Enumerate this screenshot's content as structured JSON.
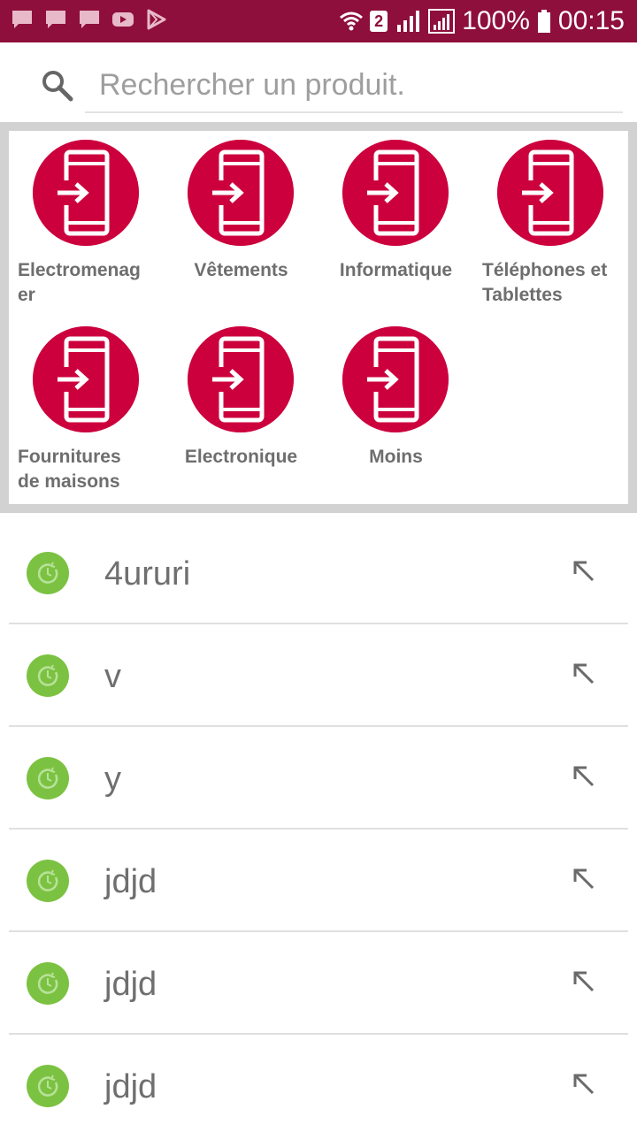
{
  "status_bar": {
    "battery": "100%",
    "time": "00:15",
    "sim_slot": "2",
    "bg_color": "#8e0f3b",
    "left_icons": [
      "message-icon",
      "message-icon",
      "message-icon",
      "youtube-icon",
      "play-store-icon"
    ],
    "right_icons": [
      "wifi-icon",
      "signal-icon",
      "signal-icon",
      "battery-icon"
    ]
  },
  "search": {
    "placeholder": "Rechercher un produit.",
    "value": ""
  },
  "categories": [
    {
      "label": "Electromenag\ner",
      "icon": "phone-login-icon"
    },
    {
      "label": "Vêtements",
      "icon": "phone-login-icon"
    },
    {
      "label": "Informatique",
      "icon": "phone-login-icon"
    },
    {
      "label": "Téléphones et\nTablettes",
      "icon": "phone-login-icon"
    },
    {
      "label": "Fournitures\nde maisons",
      "icon": "phone-login-icon"
    },
    {
      "label": "Electronique",
      "icon": "phone-login-icon"
    },
    {
      "label": "Moins",
      "icon": "phone-login-icon"
    }
  ],
  "history": [
    {
      "text": "4ururi"
    },
    {
      "text": "v"
    },
    {
      "text": "y"
    },
    {
      "text": "jdjd"
    },
    {
      "text": "jdjd"
    },
    {
      "text": "jdjd"
    }
  ],
  "colors": {
    "accent": "#cc003d",
    "history_icon": "#7cc242",
    "label_gray": "#6e6e6e"
  }
}
